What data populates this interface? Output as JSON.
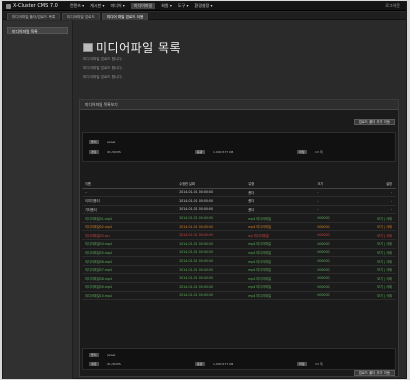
{
  "app": {
    "title": "X-Cluster CMS 7.0"
  },
  "menu": [
    "컨텐츠 ▾",
    "게시판 ▾",
    "미디어 ▾",
    "미디어파일",
    "회원 ▾",
    "도구 ▾",
    "환경설정 ▾"
  ],
  "top_right": "로그아웃",
  "tabs": [
    "미디어파일 폴더/업로드 목록",
    "미디어파일 업로드",
    "미디어 파일 업로드 이용"
  ],
  "sidebar": {
    "active_item": "미디어파일 목록"
  },
  "page": {
    "title": "미디어파일 목록",
    "subtitles": [
      "미디어파일 업로드 합니다.",
      "미디어파일 업로드 합니다.",
      "미디어파일 업로드 합니다."
    ]
  },
  "panel": {
    "title": "미디어파일 목록보기",
    "top_button": "업로드 폴더 추가 이동",
    "bottom_button": "업로드 폴더 추가 이동",
    "info": {
      "name_label": "폴더",
      "name_value": "/www",
      "path_label": "경로",
      "path_value": "/D:/XCMS",
      "size_label": "용량",
      "size_value": "1,000,577 KB",
      "count_label": "파일",
      "count_value": "13 개"
    }
  },
  "table": {
    "headers": [
      "이름",
      "수정한 날짜",
      "유형",
      "크기",
      "설정"
    ],
    "rows": [
      {
        "kind": "dir",
        "cells": [
          "..",
          "2014-01-01 00:00:00",
          "폴더",
          "-",
          "-"
        ]
      },
      {
        "kind": "dir",
        "cells": [
          "이미지폴더",
          "2014-01-01 00:00:00",
          "폴더",
          "-",
          "-"
        ]
      },
      {
        "kind": "dir",
        "cells": [
          "기타폴더",
          "2014-01-01 00:00:00",
          "폴더",
          "-",
          "-"
        ]
      },
      {
        "kind": "green",
        "cells": [
          "미디어파일01.mp4",
          "2014-01-01 00:00:00",
          "mp4 미디어파일",
          "000000",
          "보기 | 삭제"
        ]
      },
      {
        "kind": "orange",
        "cells": [
          "미디어파일02.mp4",
          "2014-01-01 00:00:00",
          "mp4 미디어파일",
          "000000",
          "보기 | 삭제"
        ]
      },
      {
        "kind": "red",
        "cells": [
          "미디어파일03.avi",
          "2014-01-01 00:00:00",
          "avi 미디어파일",
          "000000",
          "보기 | 삭제"
        ]
      },
      {
        "kind": "green",
        "cells": [
          "미디어파일04.mp4",
          "2014-01-01 00:00:00",
          "mp4 미디어파일",
          "000000",
          "보기 | 삭제"
        ]
      },
      {
        "kind": "green",
        "cells": [
          "미디어파일05.mp4",
          "2014-01-01 00:00:00",
          "mp4 미디어파일",
          "000000",
          "보기 | 삭제"
        ]
      },
      {
        "kind": "green",
        "cells": [
          "미디어파일06.mp4",
          "2014-01-01 00:00:00",
          "mp4 미디어파일",
          "000000",
          "보기 | 삭제"
        ]
      },
      {
        "kind": "green",
        "cells": [
          "미디어파일07.mp4",
          "2014-01-01 00:00:00",
          "mp4 미디어파일",
          "000000",
          "보기 | 삭제"
        ]
      },
      {
        "kind": "green",
        "cells": [
          "미디어파일08.mp4",
          "2014-01-01 00:00:00",
          "mp4 미디어파일",
          "000000",
          "보기 | 삭제"
        ]
      },
      {
        "kind": "green",
        "cells": [
          "미디어파일09.mp4",
          "2014-01-01 00:00:00",
          "mp4 미디어파일",
          "000000",
          "보기 | 삭제"
        ]
      },
      {
        "kind": "green",
        "cells": [
          "미디어파일10.mp4",
          "2014-01-01 00:00:00",
          "mp4 미디어파일",
          "000000",
          "보기 | 삭제"
        ]
      }
    ]
  },
  "colors": {
    "background": "#2a2a2a",
    "file_green": "#5fb25f",
    "file_orange": "#d9822b",
    "file_red": "#d04545"
  }
}
